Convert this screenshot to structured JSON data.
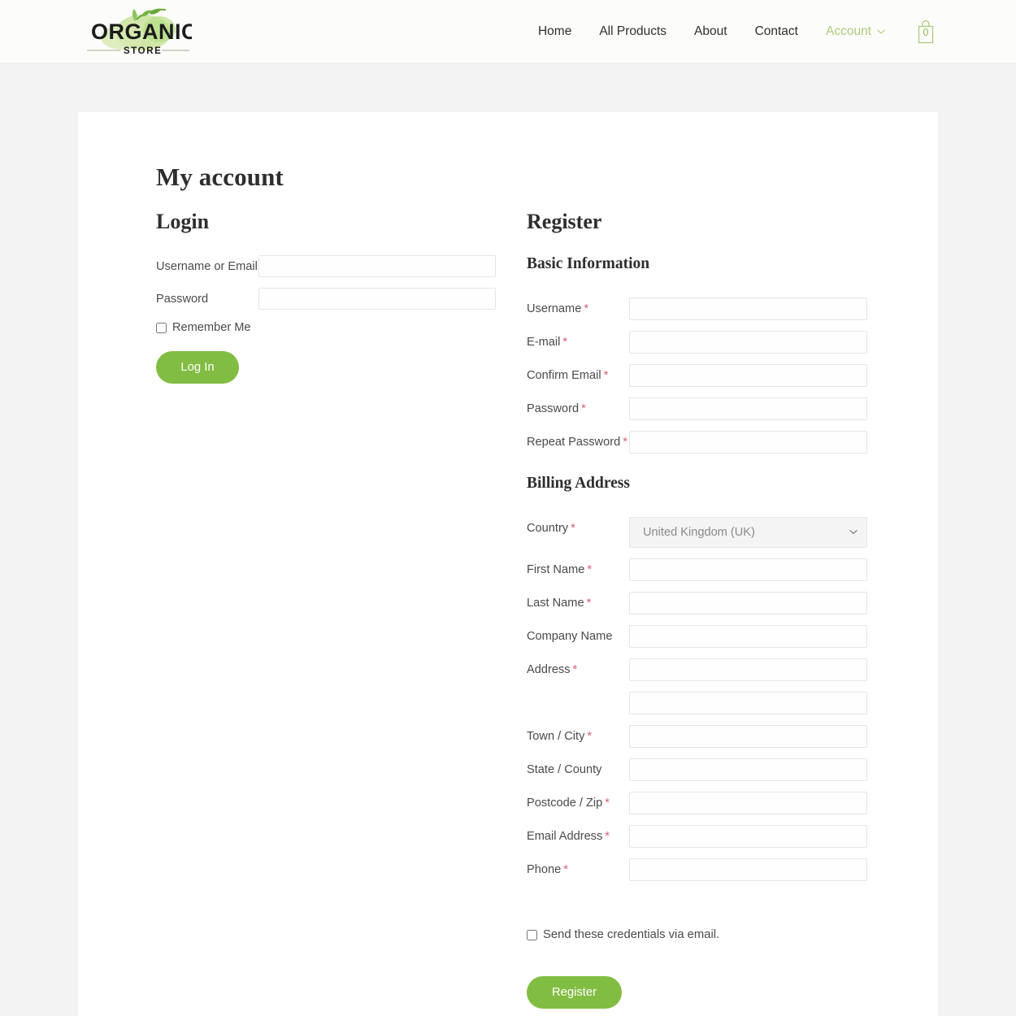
{
  "header": {
    "logo": {
      "primary": "ORGANIC",
      "secondary": "STORE",
      "icon": "organic-store-logo"
    },
    "nav": [
      {
        "label": "Home",
        "active": false
      },
      {
        "label": "All Products",
        "active": false
      },
      {
        "label": "About",
        "active": false
      },
      {
        "label": "Contact",
        "active": false
      },
      {
        "label": "Account",
        "active": true
      }
    ],
    "cart": {
      "count": "0",
      "icon": "shopping-bag-icon"
    },
    "colors": {
      "accent_green": "#82bd43",
      "nav_active": "#a9cb7d",
      "header_bg": "#fcfdfa"
    }
  },
  "page": {
    "title": "My account"
  },
  "login": {
    "heading": "Login",
    "username_label": "Username or Email",
    "username_value": "",
    "password_label": "Password",
    "password_value": "",
    "remember_label": "Remember Me",
    "remember_checked": false,
    "submit_label": "Log In"
  },
  "register": {
    "heading": "Register",
    "basic_heading": "Basic Information",
    "basic_fields": [
      {
        "label": "Username",
        "required": true,
        "value": ""
      },
      {
        "label": "E-mail",
        "required": true,
        "value": ""
      },
      {
        "label": "Confirm Email",
        "required": true,
        "value": ""
      },
      {
        "label": "Password",
        "required": true,
        "value": ""
      },
      {
        "label": "Repeat Password",
        "required": true,
        "value": ""
      }
    ],
    "billing_heading": "Billing Address",
    "country": {
      "label": "Country",
      "required": true,
      "selected": "United Kingdom (UK)",
      "options": [
        "United Kingdom (UK)"
      ]
    },
    "billing_fields": [
      {
        "label": "First Name",
        "required": true,
        "value": ""
      },
      {
        "label": "Last Name",
        "required": true,
        "value": ""
      },
      {
        "label": "Company Name",
        "required": false,
        "value": ""
      },
      {
        "label": "Address",
        "required": true,
        "value": ""
      }
    ],
    "address_line2": {
      "label": "",
      "required": false,
      "value": ""
    },
    "billing_fields_2": [
      {
        "label": "Town / City",
        "required": true,
        "value": ""
      },
      {
        "label": "State / County",
        "required": false,
        "value": ""
      },
      {
        "label": "Postcode / Zip",
        "required": true,
        "value": ""
      },
      {
        "label": "Email Address",
        "required": true,
        "value": ""
      },
      {
        "label": "Phone",
        "required": true,
        "value": ""
      }
    ],
    "send_credentials_label": "Send these credentials via email.",
    "send_credentials_checked": false,
    "submit_label": "Register"
  },
  "required_marker": "*"
}
